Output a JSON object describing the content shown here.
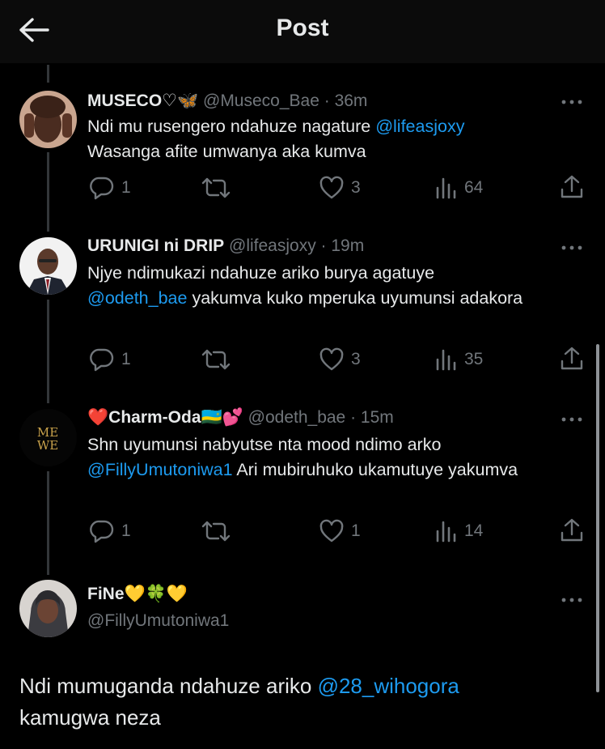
{
  "header": {
    "title": "Post"
  },
  "replies": [
    {
      "name": "MUSECO♡🦋",
      "handle": "@Museco_Bae",
      "time": "· 36m",
      "text_parts": [
        "Ndi mu rusengero ndahuze nagature ",
        "@lifeasjoxy",
        "Wasanga afite umwanya aka kumva"
      ],
      "stats": {
        "replies": "1",
        "reposts": "",
        "likes": "3",
        "views": "64"
      }
    },
    {
      "name": "URUNIGI ni DRIP",
      "handle": "@lifeasjoxy",
      "time": "· 19m",
      "text_parts": [
        "Njye ndimukazi ndahuze ariko burya agatuye ",
        "@odeth_bae",
        " yakumva kuko mperuka uyumunsi adakora"
      ],
      "stats": {
        "replies": "1",
        "reposts": "",
        "likes": "3",
        "views": "35"
      }
    },
    {
      "name": "❤️Charm-Oda🇷🇼💕",
      "handle": "@odeth_bae",
      "time": "· 15m",
      "text_parts": [
        "Shn uyumunsi nabyutse nta mood ndimo arko ",
        "@FillyUmutoniwa1",
        " Ari mubiruhuko ukamutuye yakumva"
      ],
      "stats": {
        "replies": "1",
        "reposts": "",
        "likes": "1",
        "views": "14"
      }
    }
  ],
  "main_post": {
    "name": "FiNe💛🍀💛",
    "handle": "@FillyUmutoniwa1",
    "text_parts": [
      "Ndi mumuganda ndahuze ariko ",
      "@28_wihogora",
      " kamugwa neza"
    ]
  },
  "colors": {
    "background": "#000000",
    "text": "#e7e9ea",
    "muted": "#71767b",
    "link": "#1d9bf0"
  }
}
